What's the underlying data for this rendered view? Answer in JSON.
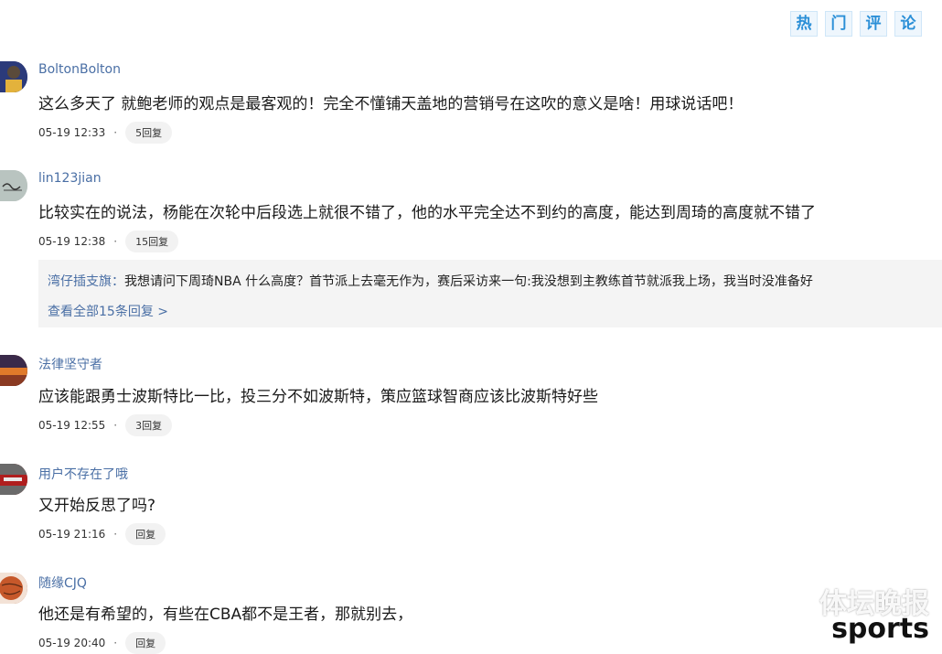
{
  "header": {
    "chars": [
      "热",
      "门",
      "评",
      "论"
    ]
  },
  "comments": [
    {
      "user": "BoltonBolton",
      "text": "这么多天了 就鲍老师的观点是最客观的！完全不懂铺天盖地的营销号在这吹的意义是啥！用球说话吧！",
      "time": "05-19 12:33",
      "reply_label": "5回复",
      "avatar_color": "#2b3a7a"
    },
    {
      "user": "lin123jian",
      "text": "比较实在的说法，杨能在次轮中后段选上就很不错了，他的水平完全达不到约的高度，能达到周琦的高度就不错了",
      "time": "05-19 12:38",
      "reply_label": "15回复",
      "avatar_color": "#b9c4c0"
    },
    {
      "user": "法律坚守者",
      "text": "应该能跟勇士波斯特比一比，投三分不如波斯特，策应篮球智商应该比波斯特好些",
      "time": "05-19 12:55",
      "reply_label": "3回复",
      "avatar_color": "#c0602a"
    },
    {
      "user": "用户不存在了哦",
      "text": "又开始反思了吗?",
      "time": "05-19 21:16",
      "reply_label": "回复",
      "avatar_color": "#8a1e1e"
    },
    {
      "user": "随缘CJQ",
      "text": "他还是有希望的，有些在CBA都不是王者，那就别去，",
      "time": "05-19 20:40",
      "reply_label": "回复",
      "avatar_color": "#a8542e"
    }
  ],
  "reply_preview": {
    "author": "湾仔插支旗：",
    "text": "我想请问下周琦NBA 什么高度？首节派上去毫无作为，赛后采访来一句:我没想到主教练首节就派我上场，我当时没准备好",
    "more": "查看全部15条回复 >"
  },
  "watermark": {
    "top": "体坛晚报",
    "bottom": "sports"
  },
  "separator": "·"
}
